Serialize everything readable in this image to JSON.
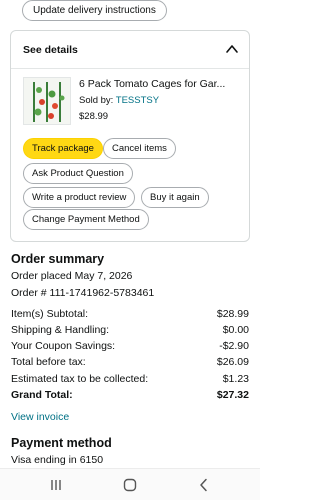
{
  "top": {
    "update_delivery_label": "Update delivery instructions"
  },
  "details": {
    "header": "See details",
    "product_title": "6 Pack Tomato Cages for Gar...",
    "sold_by_label": "Sold by: ",
    "seller": "TESSTSY",
    "price": "$28.99",
    "buttons": {
      "track": "Track package",
      "cancel": "Cancel items",
      "ask": "Ask Product Question",
      "review": "Write a product review",
      "buy_again": "Buy it again",
      "change_payment": "Change Payment Method"
    }
  },
  "summary": {
    "title": "Order summary",
    "placed": "Order placed May 7, 2026",
    "order_number": "Order # 111-1741962-5783461",
    "rows": [
      {
        "label": "Item(s) Subtotal:",
        "value": "$28.99"
      },
      {
        "label": "Shipping & Handling:",
        "value": "$0.00"
      },
      {
        "label": "Your Coupon Savings:",
        "value": "-$2.90"
      },
      {
        "label": "Total before tax:",
        "value": "$26.09"
      },
      {
        "label": "Estimated tax to be collected:",
        "value": "$1.23"
      },
      {
        "label": "Grand Total:",
        "value": "$27.32"
      }
    ],
    "view_invoice": "View invoice"
  },
  "payment": {
    "title": "Payment method",
    "card": "Visa  ending in 6150"
  },
  "nav": {
    "icons": [
      "recent-apps-icon",
      "home-icon",
      "back-icon"
    ]
  },
  "colors": {
    "primary_button": "#ffd814",
    "link": "#007185",
    "border": "#d5d9d9"
  }
}
